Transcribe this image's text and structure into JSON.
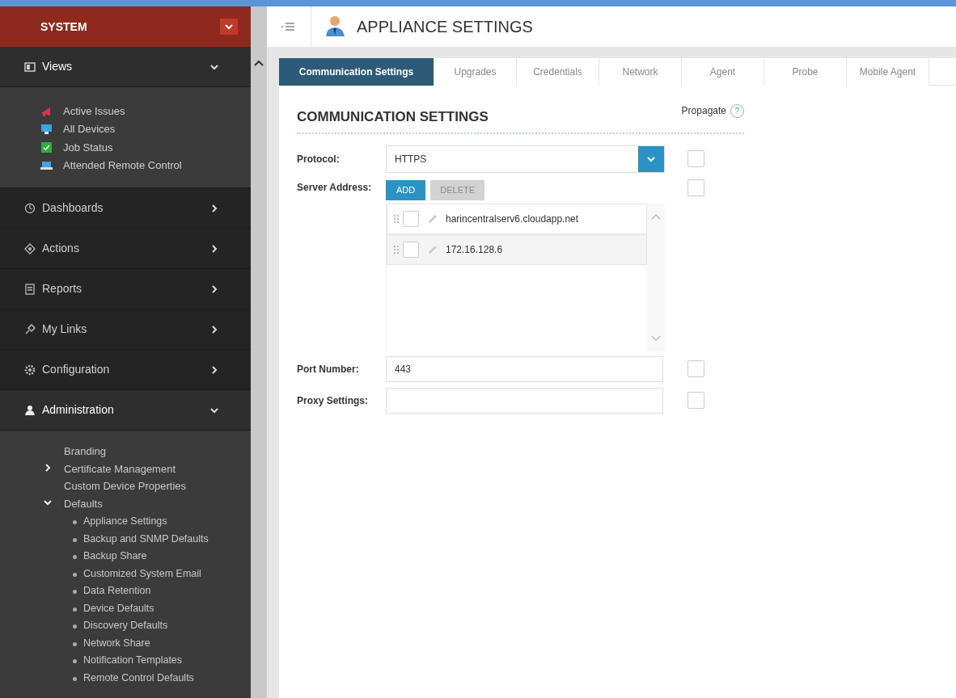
{
  "sidebar": {
    "title": "SYSTEM",
    "sections": [
      {
        "label": "Views",
        "expanded": true,
        "items": [
          {
            "label": "Active Issues"
          },
          {
            "label": "All Devices"
          },
          {
            "label": "Job Status"
          },
          {
            "label": "Attended Remote Control"
          }
        ]
      },
      {
        "label": "Dashboards",
        "expanded": false
      },
      {
        "label": "Actions",
        "expanded": false
      },
      {
        "label": "Reports",
        "expanded": false
      },
      {
        "label": "My Links",
        "expanded": false
      },
      {
        "label": "Configuration",
        "expanded": false
      },
      {
        "label": "Administration",
        "expanded": true,
        "tree": [
          {
            "label": "Branding"
          },
          {
            "label": "Certificate Management",
            "expanded": false
          },
          {
            "label": "Custom Device Properties"
          },
          {
            "label": "Defaults",
            "expanded": true,
            "children": [
              {
                "label": "Appliance Settings"
              },
              {
                "label": "Backup and SNMP Defaults"
              },
              {
                "label": "Backup Share"
              },
              {
                "label": "Customized System Email"
              },
              {
                "label": "Data Retention"
              },
              {
                "label": "Device Defaults"
              },
              {
                "label": "Discovery Defaults"
              },
              {
                "label": "Network Share"
              },
              {
                "label": "Notification Templates"
              },
              {
                "label": "Remote Control Defaults"
              }
            ]
          }
        ]
      }
    ]
  },
  "page": {
    "title": "APPLIANCE SETTINGS"
  },
  "tabs": [
    {
      "label": "Communication Settings",
      "selected": true
    },
    {
      "label": "Upgrades",
      "selected": false
    },
    {
      "label": "Credentials",
      "selected": false
    },
    {
      "label": "Network",
      "selected": false
    },
    {
      "label": "Agent",
      "selected": false
    },
    {
      "label": "Probe",
      "selected": false
    },
    {
      "label": "Mobile Agent",
      "selected": false
    }
  ],
  "section": {
    "title": "COMMUNICATION SETTINGS",
    "propagate_label": "Propagate",
    "help": "?"
  },
  "form": {
    "protocol": {
      "label": "Protocol:",
      "value": "HTTPS",
      "propagate": false
    },
    "server_address": {
      "label": "Server Address:",
      "add": "ADD",
      "delete": {
        "label": "DELETE",
        "disabled": true
      },
      "propagate": false,
      "entries": [
        {
          "value": "harincentralserv6.cloudapp.net",
          "checked": false
        },
        {
          "value": "172.16.128.6",
          "checked": false
        }
      ]
    },
    "port": {
      "label": "Port Number:",
      "value": "443",
      "propagate": false
    },
    "proxy": {
      "label": "Proxy Settings:",
      "propagate": false
    }
  }
}
